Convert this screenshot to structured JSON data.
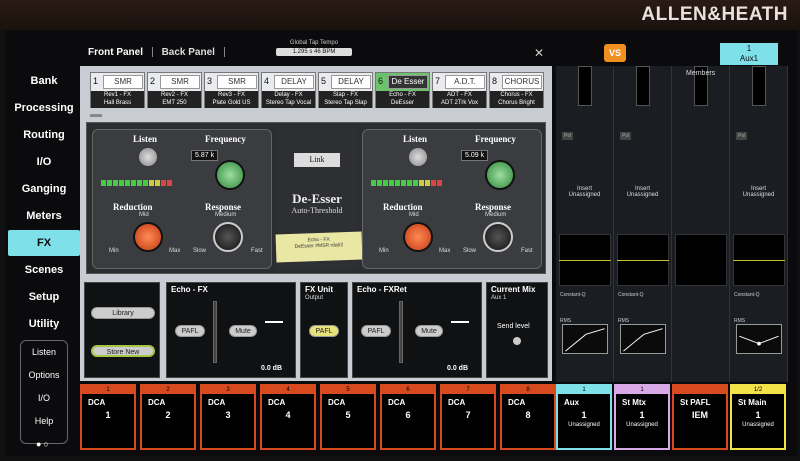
{
  "brand": "ALLEN&HEATH",
  "nav": {
    "items": [
      "Bank",
      "Processing",
      "Routing",
      "I/O",
      "Ganging",
      "Meters",
      "FX",
      "Scenes",
      "Setup",
      "Utility"
    ],
    "active": "FX",
    "sub": [
      "Listen",
      "Options",
      "I/O",
      "Help"
    ]
  },
  "panel_tabs": {
    "front": "Front Panel",
    "back": "Back Panel"
  },
  "tempo": {
    "label": "Global Tap Tempo",
    "value": "1.295 s   46 BPM"
  },
  "fx_slots": [
    {
      "num": "1",
      "logo": "SMR",
      "name": "Rev1 - FX",
      "sub": "Hall Brass"
    },
    {
      "num": "2",
      "logo": "SMR",
      "name": "Rev2 - FX",
      "sub": "EMT 250"
    },
    {
      "num": "3",
      "logo": "SMR",
      "name": "Rev3 - FX",
      "sub": "Plate Gold US"
    },
    {
      "num": "4",
      "logo": "DELAY",
      "name": "Delay - FX",
      "sub": "Stereo Tap Vocal"
    },
    {
      "num": "5",
      "logo": "DELAY",
      "name": "Slap - FX",
      "sub": "Stereo Tap Slap"
    },
    {
      "num": "6",
      "logo": "De Esser",
      "name": "Echo - FX",
      "sub": "DeEsser"
    },
    {
      "num": "7",
      "logo": "A.D.T.",
      "name": "ADT - FX",
      "sub": "ADT 2Trk Vox"
    },
    {
      "num": "8",
      "logo": "CHORUS",
      "name": "Chorus - FX",
      "sub": "Chorus Bright"
    }
  ],
  "deesser": {
    "listen": "Listen",
    "frequency": "Frequency",
    "reduction": "Reduction",
    "response": "Response",
    "left_freq": "5.87 k",
    "right_freq": "5.09 k",
    "mid": "Mid",
    "medium": "Medium",
    "min": "Min",
    "max": "Max",
    "slow": "Slow",
    "fast": "Fast",
    "link": "Link",
    "title": "De-Esser",
    "subtitle": "Auto-Threshold",
    "note_line1": "Echo - FX",
    "note_line2": "DeEsser #MSR rdalr2"
  },
  "bottom": {
    "library": "Library",
    "store_new": "Store New",
    "echo_title": "Echo - FX",
    "echo_pafl": "PAFL",
    "echo_mute": "Mute",
    "echo_db": "0.0 dB",
    "unit_title": "FX Unit",
    "unit_sub": "Output",
    "unit_pafl": "PAFL",
    "ret_title": "Echo - FXRet",
    "ret_pafl": "PAFL",
    "ret_mute": "Mute",
    "ret_db": "0.0 dB",
    "mix_title": "Current Mix",
    "mix_sub": "Aux 1",
    "send_level": "Send level"
  },
  "right": {
    "vs": "VS",
    "aux_num": "1",
    "aux_name": "Aux1",
    "members": "Members",
    "strips": [
      {
        "pol": "Pol",
        "insert1": "Insert",
        "insert2": "Unassigned",
        "cq": "Constant-Q",
        "rms": "RMS"
      },
      {
        "pol": "Pol",
        "insert1": "Insert",
        "insert2": "Unassigned",
        "cq": "Constant-Q",
        "rms": "RMS"
      },
      {
        "pol": "",
        "insert1": "",
        "insert2": "",
        "cq": "",
        "rms": ""
      },
      {
        "pol": "Pol",
        "insert1": "Insert",
        "insert2": "Unassigned",
        "cq": "Constant-Q",
        "rms": "RMS"
      }
    ]
  },
  "dcas": [
    {
      "num": "1",
      "name": "DCA",
      "val": "1"
    },
    {
      "num": "2",
      "name": "DCA",
      "val": "2"
    },
    {
      "num": "3",
      "name": "DCA",
      "val": "3"
    },
    {
      "num": "4",
      "name": "DCA",
      "val": "4"
    },
    {
      "num": "5",
      "name": "DCA",
      "val": "5"
    },
    {
      "num": "6",
      "name": "DCA",
      "val": "6"
    },
    {
      "num": "7",
      "name": "DCA",
      "val": "7"
    },
    {
      "num": "8",
      "name": "DCA",
      "val": "8"
    }
  ],
  "outputs": [
    {
      "num": "1",
      "name": "Aux",
      "val": "1",
      "sub": "Unassigned"
    },
    {
      "num": "1",
      "name": "St Mtx",
      "val": "1",
      "sub": "Unassigned"
    },
    {
      "num": "",
      "name": "St PAFL",
      "val": "IEM",
      "sub": ""
    },
    {
      "num": "1/2",
      "name": "St Main",
      "val": "1",
      "sub": "Unassigned"
    }
  ]
}
